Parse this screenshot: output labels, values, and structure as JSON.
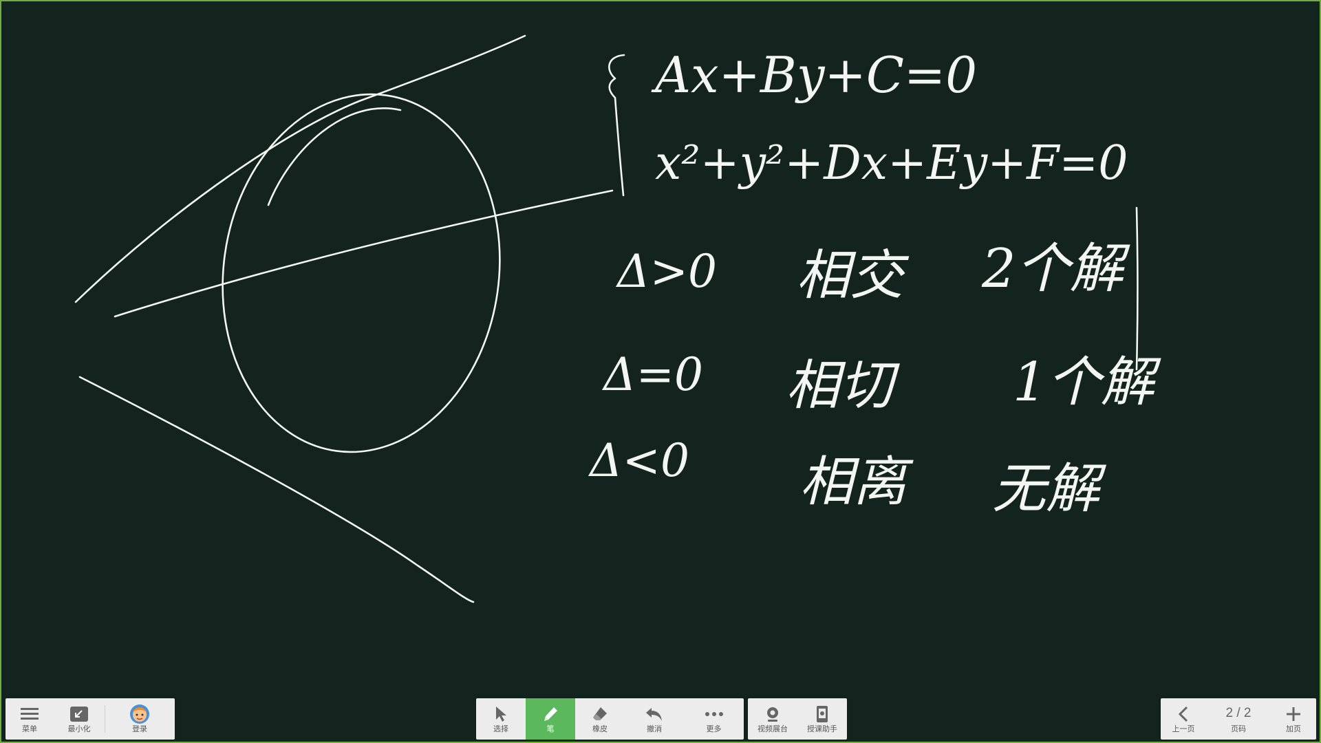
{
  "colors": {
    "board_background": "#13231e",
    "ink": "#f4f6f3",
    "frame_border": "#6fae3f",
    "toolbar_background": "#ececec",
    "active_tool": "#5cb85c"
  },
  "board": {
    "handwriting": {
      "line_system_a": "Ax+By+C=0",
      "line_system_b": "x²+y²+Dx+Ey+F=0",
      "delta_gt": "Δ>0",
      "relation_gt": "相交",
      "solutions_gt": "2个解",
      "delta_eq": "Δ=0",
      "relation_eq": "相切",
      "solutions_eq": "1个解",
      "delta_lt": "Δ<0",
      "relation_lt": "相离",
      "solutions_lt": "无解"
    }
  },
  "toolbar_left": {
    "menu": {
      "label": "菜单",
      "icon": "menu-icon"
    },
    "minimize": {
      "label": "最小化",
      "icon": "minimize-icon"
    },
    "login": {
      "label": "登录",
      "icon": "avatar-icon"
    }
  },
  "toolbar_center": {
    "select": {
      "label": "选择",
      "icon": "cursor-icon"
    },
    "pen": {
      "label": "笔",
      "icon": "pen-icon",
      "active": true
    },
    "eraser": {
      "label": "橡皮",
      "icon": "eraser-icon"
    },
    "undo": {
      "label": "撤消",
      "icon": "undo-icon"
    },
    "more": {
      "label": "更多",
      "icon": "more-icon"
    }
  },
  "toolbar_media": {
    "video_booth": {
      "label": "视频展台",
      "icon": "camera-icon"
    },
    "teaching_assistant": {
      "label": "授课助手",
      "icon": "phone-icon"
    }
  },
  "toolbar_right": {
    "prev_page": {
      "label": "上一页",
      "icon": "chevron-left-icon"
    },
    "page_number": {
      "value": "2 / 2",
      "label": "页码"
    },
    "add_page": {
      "label": "加页",
      "icon": "plus-icon"
    }
  }
}
